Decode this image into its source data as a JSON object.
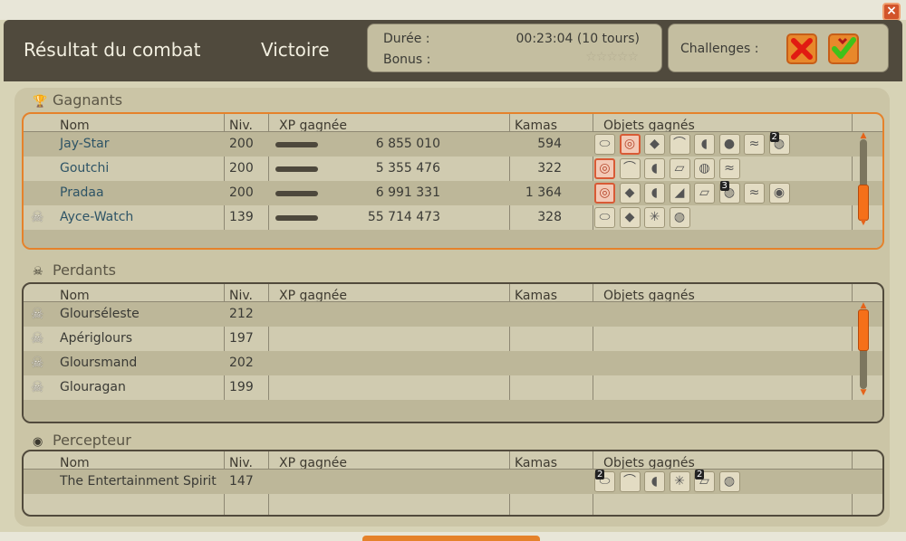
{
  "header": {
    "title": "Résultat du combat",
    "result": "Victoire",
    "duration_label": "Durée :",
    "duration_value": "00:23:04 (10 tours)",
    "bonus_label": "Bonus :",
    "bonus_stars": "☆☆☆☆☆",
    "challenges_label": "Challenges :",
    "close_symbol": "×"
  },
  "columns": {
    "name": "Nom",
    "level": "Niv.",
    "xp": "XP gagnée",
    "kamas": "Kamas",
    "items": "Objets gagnés"
  },
  "winners": {
    "label": "Gagnants",
    "icon": "trophy-icon",
    "rows": [
      {
        "name": "Jay-Star",
        "level": "200",
        "xp": "6 855 010",
        "kamas": "594",
        "dead": false,
        "items": [
          {
            "icon": "⬭"
          },
          {
            "icon": "◎",
            "pink": true
          },
          {
            "icon": "◆"
          },
          {
            "icon": "⌒"
          },
          {
            "icon": "◖"
          },
          {
            "icon": "●"
          },
          {
            "icon": "≈"
          },
          {
            "icon": "◍",
            "qty": "2"
          }
        ]
      },
      {
        "name": "Goutchi",
        "level": "200",
        "xp": "5 355 476",
        "kamas": "322",
        "dead": false,
        "items": [
          {
            "icon": "◎",
            "pink": true
          },
          {
            "icon": "⌒"
          },
          {
            "icon": "◖"
          },
          {
            "icon": "▱"
          },
          {
            "icon": "◍"
          },
          {
            "icon": "≈"
          }
        ]
      },
      {
        "name": "Pradaa",
        "level": "200",
        "xp": "6 991 331",
        "kamas": "1 364",
        "dead": false,
        "items": [
          {
            "icon": "◎",
            "pink": true
          },
          {
            "icon": "◆"
          },
          {
            "icon": "◖"
          },
          {
            "icon": "◢"
          },
          {
            "icon": "▱"
          },
          {
            "icon": "◍",
            "qty": "3"
          },
          {
            "icon": "≈"
          },
          {
            "icon": "◉"
          }
        ]
      },
      {
        "name": "Ayce-Watch",
        "level": "139",
        "xp": "55 714 473",
        "kamas": "328",
        "dead": true,
        "items": [
          {
            "icon": "⬭"
          },
          {
            "icon": "◆"
          },
          {
            "icon": "✳"
          },
          {
            "icon": "◍"
          }
        ]
      }
    ]
  },
  "losers": {
    "label": "Perdants",
    "icon": "skull-crossbones-icon",
    "rows": [
      {
        "name": "Glourséleste",
        "level": "212",
        "dead": true
      },
      {
        "name": "Apériglours",
        "level": "197",
        "dead": true
      },
      {
        "name": "Gloursmand",
        "level": "202",
        "dead": true
      },
      {
        "name": "Glouragan",
        "level": "199",
        "dead": true
      }
    ]
  },
  "collector": {
    "label": "Percepteur",
    "icon": "money-bag-icon",
    "rows": [
      {
        "name": "The Entertainment Spirit",
        "level": "147",
        "items": [
          {
            "icon": "⬭",
            "qty": "2"
          },
          {
            "icon": "⌒"
          },
          {
            "icon": "◖"
          },
          {
            "icon": "✳"
          },
          {
            "icon": "▱",
            "qty": "2"
          },
          {
            "icon": "◍"
          }
        ]
      }
    ]
  },
  "colors": {
    "header_bg": "#504a3d",
    "accent_orange": "#e5822b",
    "link_name": "#2e5466"
  }
}
